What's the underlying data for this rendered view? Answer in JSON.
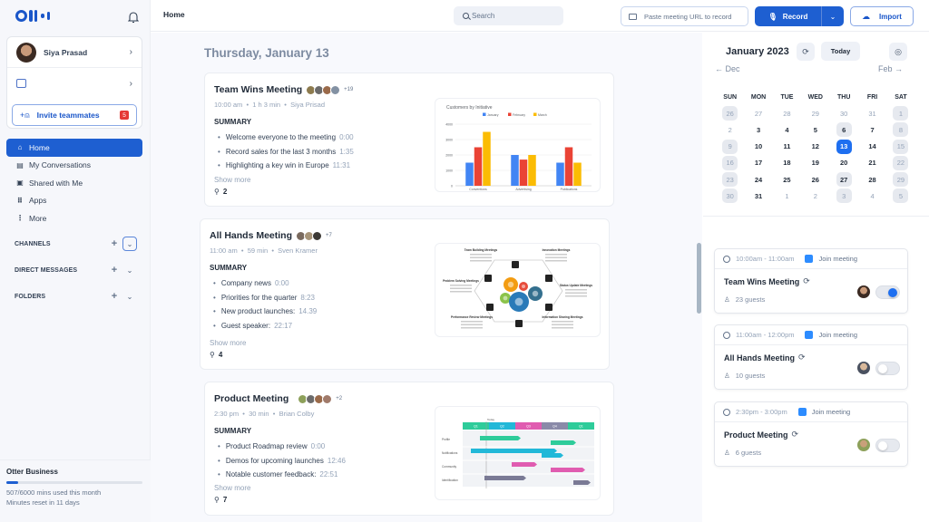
{
  "sidebar": {
    "profile_name": "Siya Prasad",
    "invite_label": "Invite teammates",
    "invite_badge": "5",
    "nav": [
      {
        "label": "Home",
        "icon": "home-icon",
        "active": true
      },
      {
        "label": "My Conversations",
        "icon": "conversations-icon"
      },
      {
        "label": "Shared with Me",
        "icon": "shared-icon"
      },
      {
        "label": "Apps",
        "icon": "apps-grid-icon"
      },
      {
        "label": "More",
        "icon": "more-vertical-icon"
      }
    ],
    "sections": [
      {
        "label": "CHANNELS"
      },
      {
        "label": "DIRECT MESSAGES"
      },
      {
        "label": "FOLDERS"
      }
    ],
    "plan": {
      "title": "Otter Business",
      "usage_text": "507/6000 mins used this month",
      "reset_text": "Minutes reset in 11 days",
      "used_minutes": 507,
      "total_minutes": 6000
    }
  },
  "header": {
    "title": "Home",
    "search_placeholder": "Search",
    "paste_placeholder": "Paste meeting URL to record",
    "record_label": "Record",
    "import_label": "Import"
  },
  "feed": {
    "date_title": "Thursday, January 13",
    "show_more_label": "Show more",
    "summary_label": "SUMMARY",
    "meetings": [
      {
        "title": "Team Wins Meeting",
        "extra_attendees": "+19",
        "time": "10:00 am",
        "duration": "1 h 3 min",
        "owner": "Siya Prisad",
        "summary": [
          {
            "text": "Welcome everyone to the meeting",
            "ts": "0:00"
          },
          {
            "text": "Record sales for the last 3 months",
            "ts": "1:35"
          },
          {
            "text": "Highlighting a key win in Europe",
            "ts": "11:31"
          }
        ],
        "comments": "2"
      },
      {
        "title": "All Hands Meeting",
        "extra_attendees": "+7",
        "time": "11:00 am",
        "duration": "59 min",
        "owner": "Sven Kramer",
        "summary": [
          {
            "text": "Company news",
            "ts": "0:00"
          },
          {
            "text": "Priorities for the quarter",
            "ts": "8:23"
          },
          {
            "text": "New product launches:",
            "ts": "14.39"
          },
          {
            "text": "Guest speaker:",
            "ts": "22:17"
          }
        ],
        "comments": "4"
      },
      {
        "title": "Product Meeting",
        "extra_attendees": "+2",
        "time": "2:30 pm",
        "duration": "30 min",
        "owner": "Brian Colby",
        "summary": [
          {
            "text": "Product Roadmap review",
            "ts": "0:00"
          },
          {
            "text": "Demos for upcoming launches",
            "ts": "12:46"
          },
          {
            "text": "Notable customer feedback:",
            "ts": "22:51"
          }
        ],
        "comments": "7"
      }
    ],
    "thumb_chart": {
      "title": "Customers by Initiative",
      "categories": [
        "Conventions",
        "Advertising",
        "Publications"
      ],
      "series": [
        {
          "name": "January",
          "color": "#4285f4",
          "values": [
            1500,
            2000,
            1500
          ]
        },
        {
          "name": "February",
          "color": "#ea4335",
          "values": [
            2500,
            1700,
            2500
          ]
        },
        {
          "name": "March",
          "color": "#fbbc04",
          "values": [
            3500,
            2000,
            1500
          ]
        }
      ],
      "yticks": [
        "0",
        "1000",
        "2000",
        "3000",
        "4000"
      ],
      "ymax": 4000
    },
    "thumb_diagram": {
      "labels": [
        "Team Building Meetings",
        "Innovation Meetings",
        "Problem Solving Meetings",
        "Status Update Meetings",
        "Performance Review Meetings",
        "Information Sharing Meetings"
      ]
    },
    "thumb_roadmap": {
      "today_label": "Today",
      "quarters": [
        "Q1",
        "Q2",
        "Q3",
        "Q4",
        "Q1"
      ],
      "quarter_colors": [
        "#2ecc9a",
        "#22b8d8",
        "#e05cb0",
        "#8a8aa8",
        "#2ecc9a"
      ],
      "rows": [
        "Profile",
        "Notifications",
        "Community",
        "Identification"
      ]
    }
  },
  "calendar": {
    "title": "January 2023",
    "today_label": "Today",
    "prev_label": "← Dec",
    "next_label": "Feb →",
    "weekdays": [
      "SUN",
      "MON",
      "TUE",
      "WED",
      "THU",
      "FRI",
      "SAT"
    ],
    "weeks": [
      [
        {
          "d": "26",
          "m": 1,
          "s": 1
        },
        {
          "d": "27",
          "m": 1
        },
        {
          "d": "28",
          "m": 1
        },
        {
          "d": "29",
          "m": 1
        },
        {
          "d": "30",
          "m": 1
        },
        {
          "d": "31",
          "m": 1
        },
        {
          "d": "1",
          "m": 1,
          "s": 1
        }
      ],
      [
        {
          "d": "2",
          "m": 1
        },
        {
          "d": "3"
        },
        {
          "d": "4"
        },
        {
          "d": "5"
        },
        {
          "d": "6",
          "s": 1
        },
        {
          "d": "7"
        },
        {
          "d": "8",
          "m": 1,
          "s": 1
        }
      ],
      [
        {
          "d": "9",
          "m": 1,
          "s": 1
        },
        {
          "d": "10"
        },
        {
          "d": "11"
        },
        {
          "d": "12"
        },
        {
          "d": "13",
          "sel": 1
        },
        {
          "d": "14"
        },
        {
          "d": "15",
          "m": 1,
          "s": 1
        }
      ],
      [
        {
          "d": "16",
          "m": 1,
          "s": 1
        },
        {
          "d": "17"
        },
        {
          "d": "18"
        },
        {
          "d": "19"
        },
        {
          "d": "20"
        },
        {
          "d": "21"
        },
        {
          "d": "22",
          "m": 1,
          "s": 1
        }
      ],
      [
        {
          "d": "23",
          "m": 1,
          "s": 1
        },
        {
          "d": "24"
        },
        {
          "d": "25"
        },
        {
          "d": "26"
        },
        {
          "d": "27",
          "s": 1
        },
        {
          "d": "28"
        },
        {
          "d": "29",
          "m": 1,
          "s": 1
        }
      ],
      [
        {
          "d": "30",
          "m": 1,
          "s": 1
        },
        {
          "d": "31"
        },
        {
          "d": "1",
          "m": 1
        },
        {
          "d": "2",
          "m": 1
        },
        {
          "d": "3",
          "m": 1,
          "s": 1
        },
        {
          "d": "4",
          "m": 1
        },
        {
          "d": "5",
          "m": 1,
          "s": 1
        }
      ]
    ],
    "selected_day": "13"
  },
  "events": [
    {
      "time": "10:00am - 11:00am",
      "join_label": "Join meeting",
      "title": "Team Wins Meeting",
      "guests": "23 guests",
      "record_on": true
    },
    {
      "time": "11:00am - 12:00pm",
      "join_label": "Join meeting",
      "title": "All Hands Meeting",
      "guests": "10 guests",
      "record_on": false
    },
    {
      "time": "2:30pm - 3:00pm",
      "join_label": "Join meeting",
      "title": "Product Meeting",
      "guests": "6 guests",
      "record_on": false
    }
  ],
  "colors": {
    "brand": "#1e5fd1",
    "selected_day": "#1e6ff0",
    "badge": "#e53935",
    "zoom": "#2d8cff"
  }
}
